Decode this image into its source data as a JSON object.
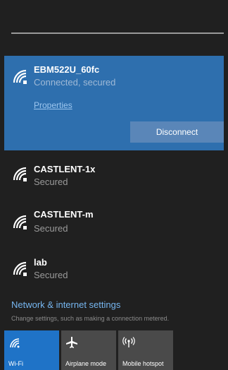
{
  "networks": [
    {
      "ssid": "EBM522U_60fc",
      "status": "Connected, secured",
      "properties_label": "Properties",
      "disconnect_label": "Disconnect"
    },
    {
      "ssid": "CASTLENT-1x",
      "status": "Secured"
    },
    {
      "ssid": "CASTLENT-m",
      "status": "Secured"
    },
    {
      "ssid": "lab",
      "status": "Secured"
    }
  ],
  "settings": {
    "title": "Network & internet settings",
    "description": "Change settings, such as making a connection metered."
  },
  "quick_actions": [
    {
      "label": "Wi-Fi",
      "icon": "wifi-icon",
      "state": "on"
    },
    {
      "label": "Airplane mode",
      "icon": "airplane-icon",
      "state": "off"
    },
    {
      "label": "Mobile hotspot",
      "icon": "hotspot-icon",
      "state": "off"
    }
  ],
  "colors": {
    "background": "#202020",
    "active_network": "#2e6fae",
    "accent": "#1f73c7",
    "link": "#76b6f0"
  }
}
